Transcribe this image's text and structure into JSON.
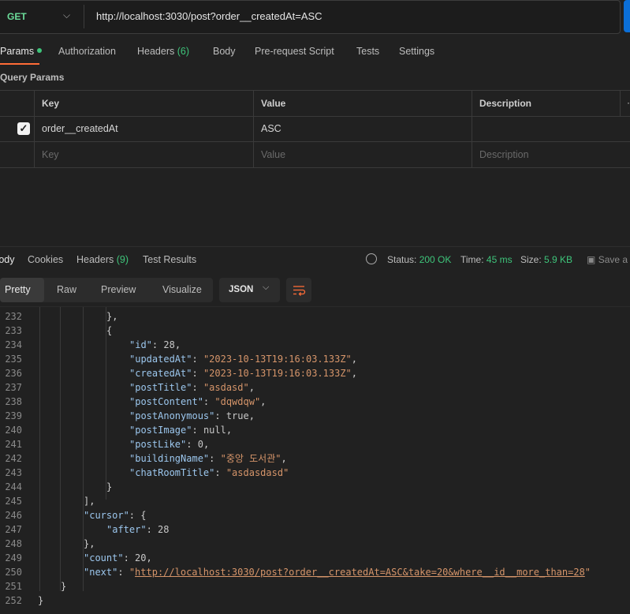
{
  "request": {
    "method": "GET",
    "url": "http://localhost:3030/post?order__createdAt=ASC"
  },
  "request_tabs": [
    {
      "label": "Params",
      "active": true
    },
    {
      "label": "Authorization"
    },
    {
      "label": "Headers",
      "count": "(6)"
    },
    {
      "label": "Body"
    },
    {
      "label": "Pre-request Script"
    },
    {
      "label": "Tests"
    },
    {
      "label": "Settings"
    }
  ],
  "query_params": {
    "title": "Query Params",
    "headers": [
      "Key",
      "Value",
      "Description"
    ],
    "rows": [
      {
        "key": "order__createdAt",
        "value": "ASC",
        "checked": true
      }
    ],
    "placeholders": {
      "key": "Key",
      "value": "Value",
      "description": "Description"
    }
  },
  "response": {
    "tabs": [
      {
        "label": "Body",
        "active": true
      },
      {
        "label": "Cookies"
      },
      {
        "label": "Headers",
        "count": "(9)"
      },
      {
        "label": "Test Results"
      }
    ],
    "status_label": "Status:",
    "status": "200 OK",
    "time_label": "Time:",
    "time": "45 ms",
    "size_label": "Size:",
    "size": "5.9 KB",
    "save_label": "Save a",
    "views": [
      "Pretty",
      "Raw",
      "Preview",
      "Visualize"
    ],
    "format": "JSON"
  },
  "colors": {
    "accent": "#ff6c37",
    "success": "#3ec47a",
    "send": "#0b6fd8"
  },
  "code_lines": [
    {
      "n": "232",
      "indent": 6,
      "parts": [
        [
          "p",
          "},"
        ]
      ]
    },
    {
      "n": "233",
      "indent": 6,
      "parts": [
        [
          "p",
          "{"
        ]
      ]
    },
    {
      "n": "234",
      "indent": 8,
      "parts": [
        [
          "k",
          "\"id\""
        ],
        [
          "p",
          ": "
        ],
        [
          "n",
          "28"
        ],
        [
          "p",
          ","
        ]
      ]
    },
    {
      "n": "235",
      "indent": 8,
      "parts": [
        [
          "k",
          "\"updatedAt\""
        ],
        [
          "p",
          ": "
        ],
        [
          "s",
          "\"2023-10-13T19:16:03.133Z\""
        ],
        [
          "p",
          ","
        ]
      ]
    },
    {
      "n": "236",
      "indent": 8,
      "parts": [
        [
          "k",
          "\"createdAt\""
        ],
        [
          "p",
          ": "
        ],
        [
          "s",
          "\"2023-10-13T19:16:03.133Z\""
        ],
        [
          "p",
          ","
        ]
      ]
    },
    {
      "n": "237",
      "indent": 8,
      "parts": [
        [
          "k",
          "\"postTitle\""
        ],
        [
          "p",
          ": "
        ],
        [
          "s",
          "\"asdasd\""
        ],
        [
          "p",
          ","
        ]
      ]
    },
    {
      "n": "238",
      "indent": 8,
      "parts": [
        [
          "k",
          "\"postContent\""
        ],
        [
          "p",
          ": "
        ],
        [
          "s",
          "\"dqwdqw\""
        ],
        [
          "p",
          ","
        ]
      ]
    },
    {
      "n": "239",
      "indent": 8,
      "parts": [
        [
          "k",
          "\"postAnonymous\""
        ],
        [
          "p",
          ": "
        ],
        [
          "n",
          "true"
        ],
        [
          "p",
          ","
        ]
      ]
    },
    {
      "n": "240",
      "indent": 8,
      "parts": [
        [
          "k",
          "\"postImage\""
        ],
        [
          "p",
          ": "
        ],
        [
          "n",
          "null"
        ],
        [
          "p",
          ","
        ]
      ]
    },
    {
      "n": "241",
      "indent": 8,
      "parts": [
        [
          "k",
          "\"postLike\""
        ],
        [
          "p",
          ": "
        ],
        [
          "n",
          "0"
        ],
        [
          "p",
          ","
        ]
      ]
    },
    {
      "n": "242",
      "indent": 8,
      "parts": [
        [
          "k",
          "\"buildingName\""
        ],
        [
          "p",
          ": "
        ],
        [
          "s",
          "\"중앙 도서관\""
        ],
        [
          "p",
          ","
        ]
      ]
    },
    {
      "n": "243",
      "indent": 8,
      "parts": [
        [
          "k",
          "\"chatRoomTitle\""
        ],
        [
          "p",
          ": "
        ],
        [
          "s",
          "\"asdasdasd\""
        ]
      ]
    },
    {
      "n": "244",
      "indent": 6,
      "parts": [
        [
          "p",
          "}"
        ]
      ]
    },
    {
      "n": "245",
      "indent": 4,
      "parts": [
        [
          "p",
          "],"
        ]
      ]
    },
    {
      "n": "246",
      "indent": 4,
      "parts": [
        [
          "k",
          "\"cursor\""
        ],
        [
          "p",
          ": {"
        ]
      ]
    },
    {
      "n": "247",
      "indent": 6,
      "parts": [
        [
          "k",
          "\"after\""
        ],
        [
          "p",
          ": "
        ],
        [
          "n",
          "28"
        ]
      ]
    },
    {
      "n": "248",
      "indent": 4,
      "parts": [
        [
          "p",
          "},"
        ]
      ]
    },
    {
      "n": "249",
      "indent": 4,
      "parts": [
        [
          "k",
          "\"count\""
        ],
        [
          "p",
          ": "
        ],
        [
          "n",
          "20"
        ],
        [
          "p",
          ","
        ]
      ]
    },
    {
      "n": "250",
      "indent": 4,
      "parts": [
        [
          "k",
          "\"next\""
        ],
        [
          "p",
          ": "
        ],
        [
          "s",
          "\""
        ],
        [
          "u",
          "http://localhost:3030/post?order__createdAt=ASC&take=20&where__id__more_than=28"
        ],
        [
          "s",
          "\""
        ]
      ]
    },
    {
      "n": "251",
      "indent": 2,
      "parts": [
        [
          "p",
          "}"
        ]
      ]
    },
    {
      "n": "252",
      "indent": 0,
      "parts": [
        [
          "p",
          "}"
        ]
      ]
    }
  ]
}
